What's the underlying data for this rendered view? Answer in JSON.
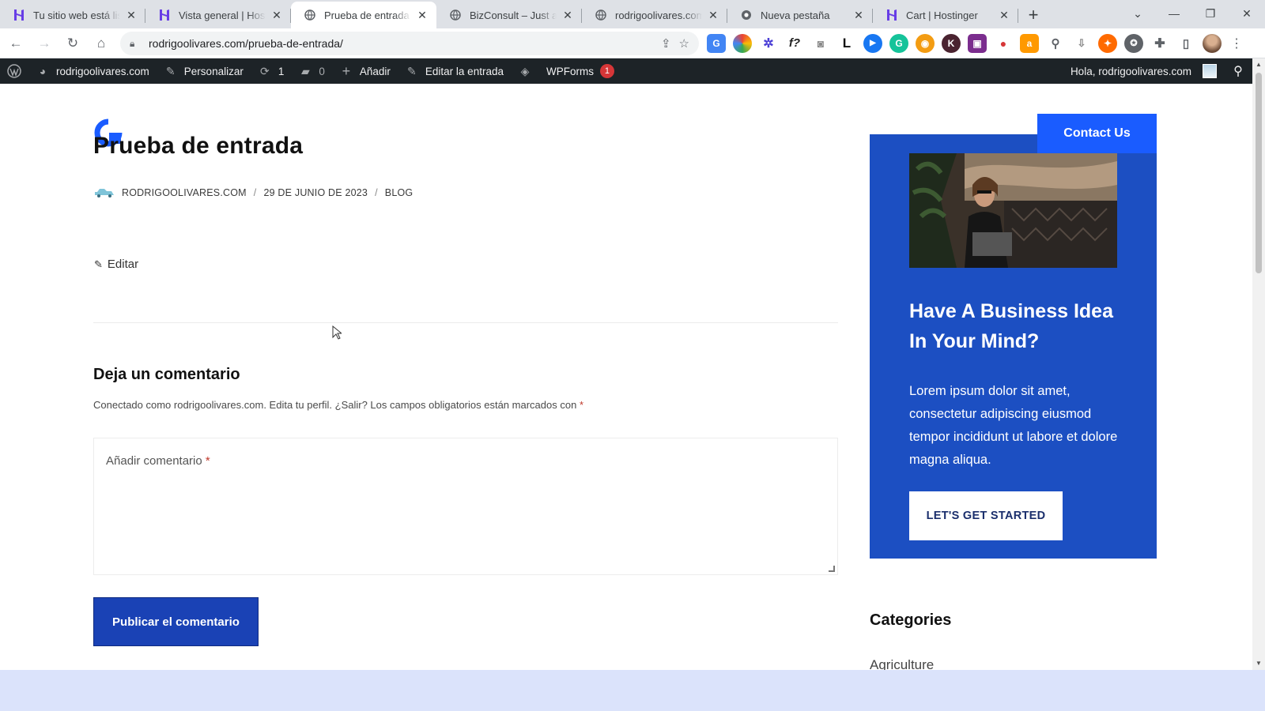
{
  "browser": {
    "tabs": [
      {
        "title": "Tu sitio web está listo",
        "favicon": "hostinger-icon",
        "active": false
      },
      {
        "title": "Vista general | Hostinger",
        "favicon": "hostinger-icon",
        "active": false
      },
      {
        "title": "Prueba de entrada – rodrigoolivares.com",
        "favicon": "globe-icon",
        "active": true
      },
      {
        "title": "BizConsult – Just another",
        "favicon": "globe-icon",
        "active": false
      },
      {
        "title": "rodrigoolivares.com",
        "favicon": "globe-icon",
        "active": false
      },
      {
        "title": "Nueva pestaña",
        "favicon": "chrome-icon",
        "active": false
      },
      {
        "title": "Cart | Hostinger",
        "favicon": "hostinger-icon",
        "active": false
      }
    ],
    "url": "rodrigoolivares.com/prueba-de-entrada/"
  },
  "adminbar": {
    "site": "rodrigoolivares.com",
    "customize": "Personalizar",
    "updates": "1",
    "comments": "0",
    "add_new": "Añadir",
    "edit_post": "Editar la entrada",
    "wpforms": "WPForms",
    "wpforms_badge": "1",
    "greeting": "Hola, rodrigoolivares.com"
  },
  "post": {
    "title": "Prueba de entrada",
    "author": "RODRIGOOLIVARES.COM",
    "date": "29 DE JUNIO DE 2023",
    "category": "BLOG",
    "separator": "/",
    "edit": "Editar"
  },
  "comments": {
    "reply_title": "Deja un comentario",
    "logged_in": "Conectado como rodrigoolivares.com. Edita tu perfil. ¿Salir? Los campos obligatorios están marcados con",
    "required_mark": "*",
    "placeholder": "Añadir comentario",
    "submit": "Publicar el comentario"
  },
  "sidebar": {
    "contact": "Contact Us",
    "promo_title": "Have A Business Idea In Your Mind?",
    "promo_text": "Lorem ipsum dolor sit amet, consectetur adipiscing eiusmod tempor incididunt ut labore et dolore magna aliqua.",
    "promo_button": "LET'S GET STARTED",
    "categories_title": "Categories",
    "first_category": "Agriculture"
  },
  "colors": {
    "admin_bar": "#1d2327",
    "brand_blue": "#1c4fc2",
    "button_blue": "#1a42b5",
    "contact_blue": "#1a5cff"
  }
}
